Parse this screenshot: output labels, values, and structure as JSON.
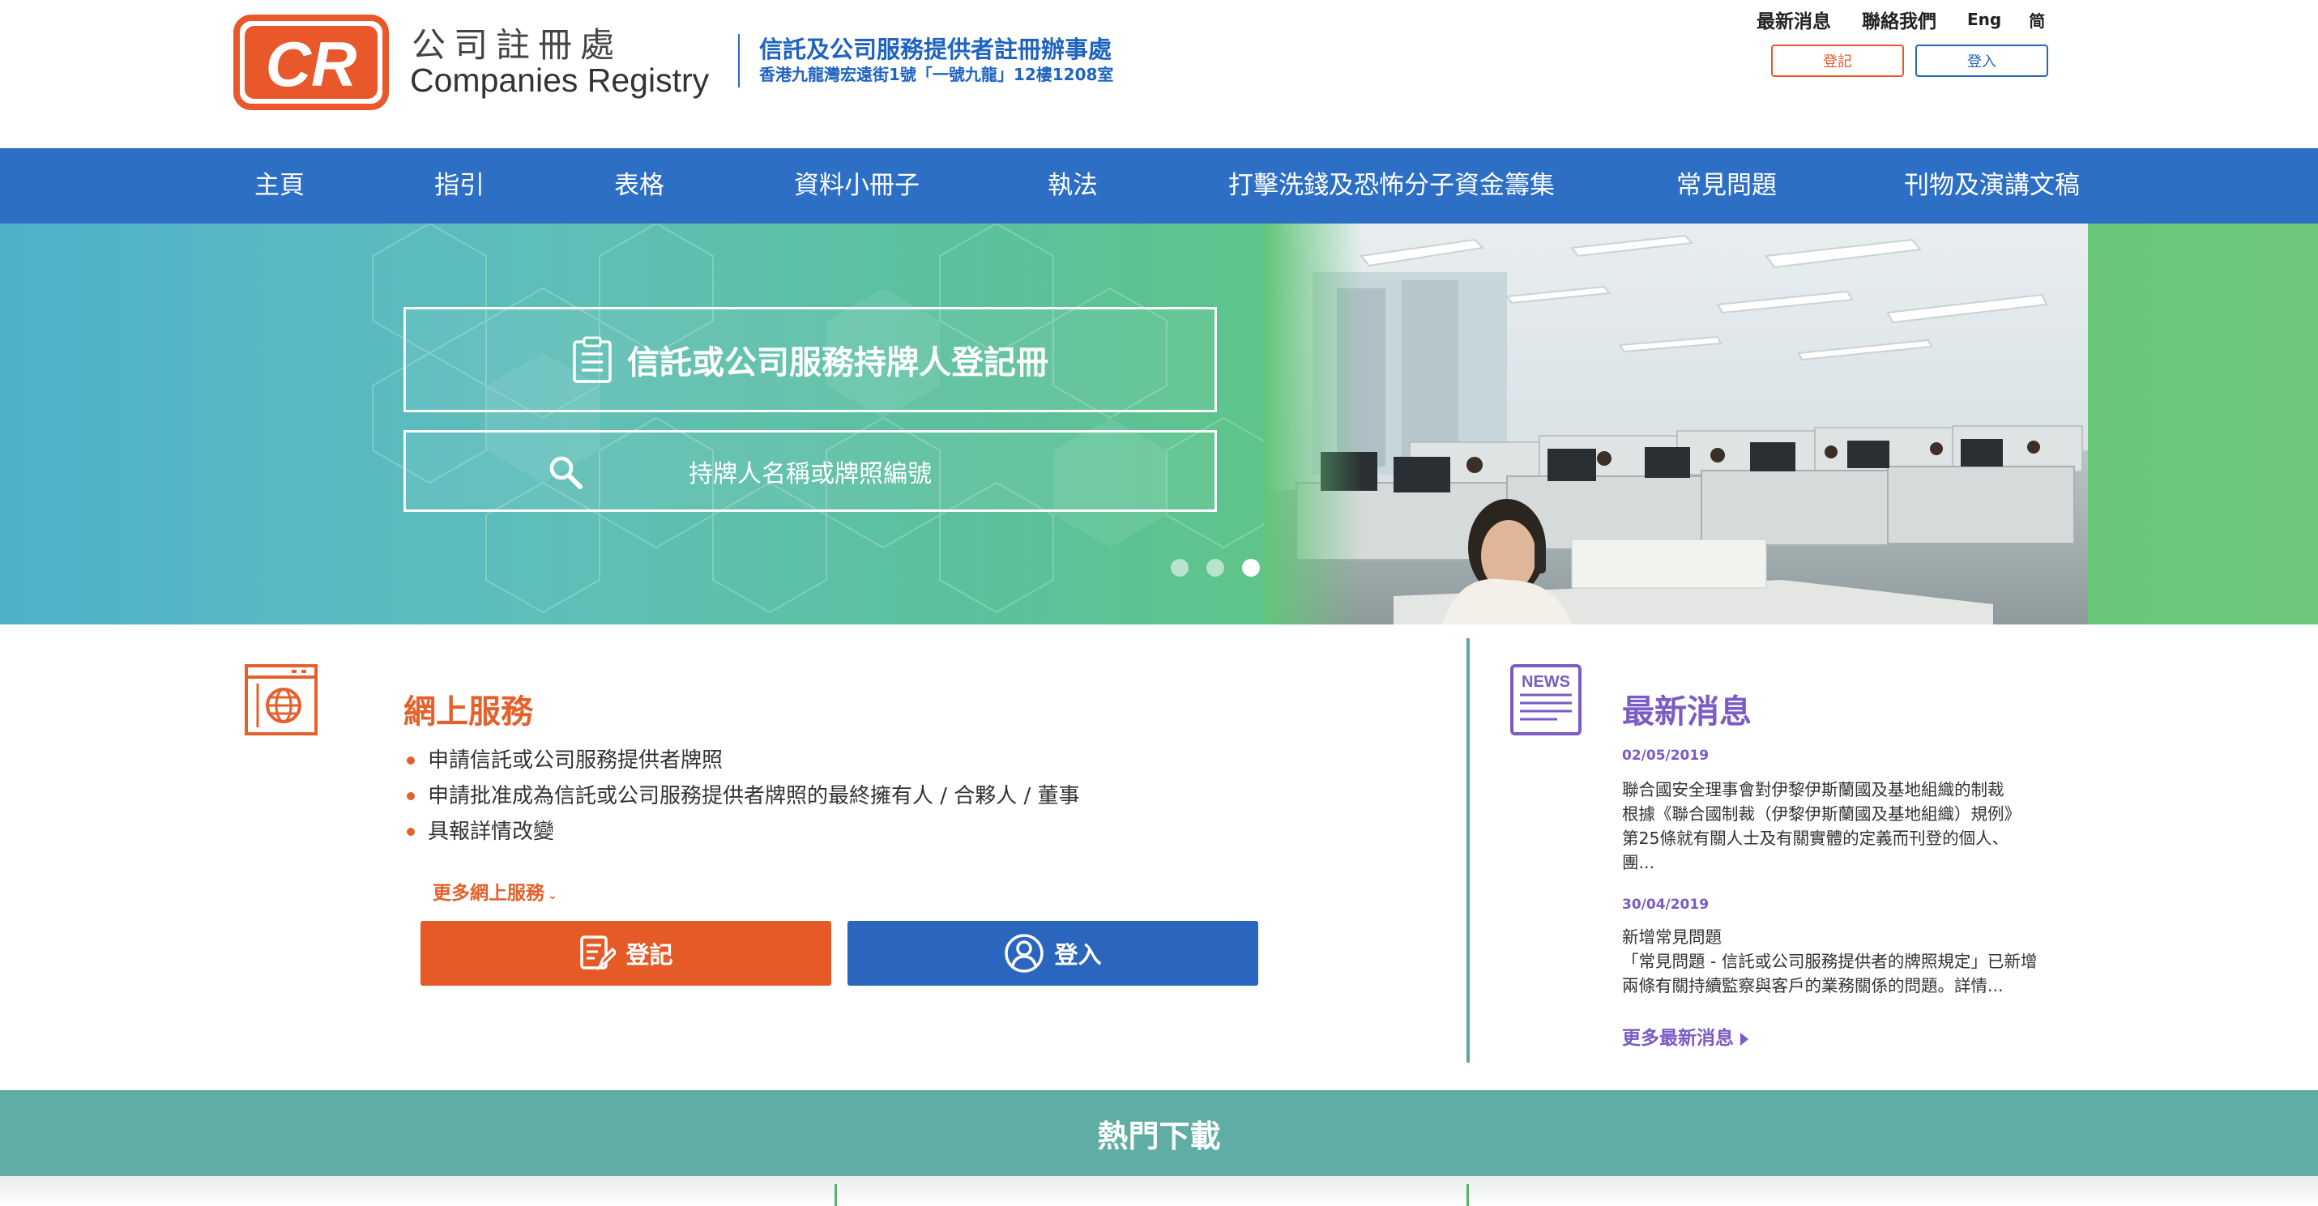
{
  "header": {
    "logo_text": "CR",
    "logo_cn": "公司註冊處",
    "logo_en": "Companies Registry",
    "office_title": "信託及公司服務提供者註冊辦事處",
    "office_address": "香港九龍灣宏遠街1號「一號九龍」12樓1208室",
    "top_links": [
      "最新消息",
      "聯絡我們"
    ],
    "lang_en": "Eng",
    "lang_sc": "简",
    "register_label": "登記",
    "login_label": "登入"
  },
  "nav": {
    "items": [
      "主頁",
      "指引",
      "表格",
      "資料小冊子",
      "執法",
      "打擊洗錢及恐怖分子資金籌集",
      "常見問題",
      "刊物及演講文稿"
    ]
  },
  "banner": {
    "register_title": "信託或公司服務持牌人登記冊",
    "search_label": "持牌人名稱或牌照編號",
    "slide_count": 3,
    "active_slide": 3
  },
  "online_services": {
    "title": "網上服務",
    "items": [
      "申請信託或公司服務提供者牌照",
      "申請批准成為信託或公司服務提供者牌照的最終擁有人 / 合夥人 / 董事",
      "具報詳情改變"
    ],
    "more_label": "更多網上服務",
    "register_label": "登記",
    "login_label": "登入"
  },
  "news": {
    "title": "最新消息",
    "icon_text": "NEWS",
    "items": [
      {
        "date": "02/05/2019",
        "lines": [
          "聯合國安全理事會對伊黎伊斯蘭國及基地組織的制裁",
          "根據《聯合國制裁（伊黎伊斯蘭國及基地組織）規例》",
          "第25條就有關人士及有關實體的定義而刊登的個人、",
          "團..."
        ]
      },
      {
        "date": "30/04/2019",
        "lines": [
          "新增常見問題",
          "「常見問題 - 信託或公司服務提供者的牌照規定」已新增",
          "兩條有關持續監察與客戶的業務關係的問題。詳情..."
        ]
      }
    ],
    "more_label": "更多最新消息"
  },
  "hot_downloads": {
    "title": "熱門下載"
  },
  "colors": {
    "nav_blue": "#2d6fc5",
    "accent_orange": "#e55a26",
    "accent_purple": "#7b5bc4",
    "teal": "#5fada4"
  }
}
